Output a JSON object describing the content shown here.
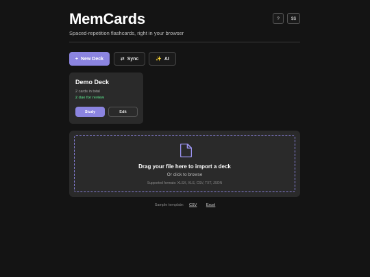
{
  "header": {
    "title": "MemCards",
    "subtitle": "Spaced-repetition flashcards, right in your browser",
    "help_label": "?",
    "dollar_label": "$$"
  },
  "toolbar": {
    "new_deck_icon": "+",
    "new_deck_label": "New Deck",
    "sync_icon": "⇄",
    "sync_label": "Sync",
    "ai_icon": "✨",
    "ai_label": "AI"
  },
  "decks": [
    {
      "title": "Demo Deck",
      "total": "2 cards in total",
      "due": "2 due for review",
      "study_label": "Study",
      "edit_label": "Edit"
    }
  ],
  "import": {
    "icon": "file-icon",
    "title": "Drag your file here to import a deck",
    "subtitle": "Or click to browse",
    "formats": "Supported formats: XLSX, XLS, CSV, TXT, JSON"
  },
  "samples": {
    "label": "Sample template:",
    "csv": "CSV",
    "excel": "Excel"
  },
  "colors": {
    "accent": "#8b84e0",
    "due": "#53c07a",
    "background": "#141414",
    "card": "#2a2a2a"
  }
}
